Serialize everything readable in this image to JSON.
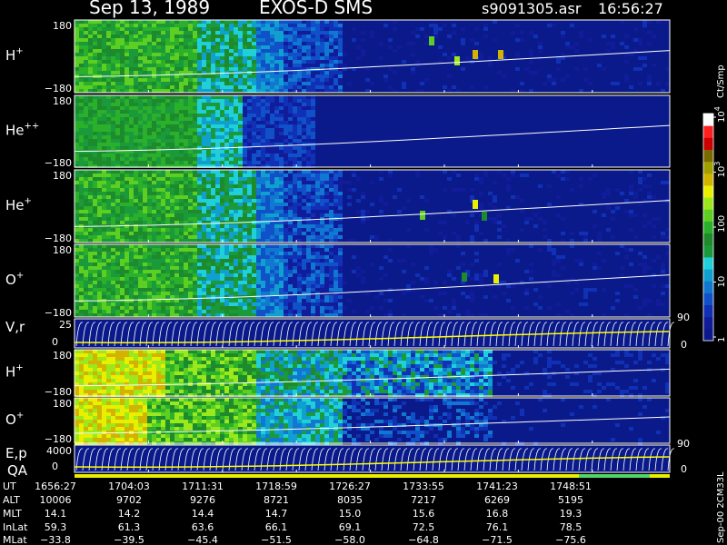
{
  "header": {
    "date": "Sep 13, 1989",
    "instrument": "EXOS-D SMS",
    "file": "s9091305.asr",
    "time": "16:56:27"
  },
  "colorbar": {
    "unit": "Ct/Smp",
    "ticks": [
      {
        "v": 1,
        "label": "1"
      },
      {
        "v": 10,
        "label": "10"
      },
      {
        "v": 100,
        "label": "100"
      },
      {
        "v": 1000,
        "label": "10",
        "sup": "3"
      },
      {
        "v": 10000,
        "label": "10",
        "sup": "4"
      }
    ],
    "colors": [
      "#0b1a8a",
      "#101c99",
      "#1030b5",
      "#1050c8",
      "#1078d0",
      "#10a0d0",
      "#20d0d8",
      "#1a9a3a",
      "#1d8a2c",
      "#2ab02a",
      "#5ccf22",
      "#9be81c",
      "#e8f000",
      "#d2b400",
      "#a0a000",
      "#7a6a00",
      "#cc0000",
      "#ff2020",
      "#ffffff"
    ]
  },
  "panels": [
    {
      "id": "h-plus",
      "label": "H",
      "sup": "+",
      "kind": "spec",
      "ymax": "180",
      "ymin": "−180",
      "pattern": "h"
    },
    {
      "id": "he-pp",
      "label": "He",
      "sup": "++",
      "kind": "spec",
      "ymax": "180",
      "ymin": "−180",
      "pattern": "hepp"
    },
    {
      "id": "he-plus",
      "label": "He",
      "sup": "+",
      "kind": "spec",
      "ymax": "180",
      "ymin": "−180",
      "pattern": "hep"
    },
    {
      "id": "o-plus",
      "label": "O",
      "sup": "+",
      "kind": "spec",
      "ymax": "180",
      "ymin": "−180",
      "pattern": "o"
    },
    {
      "id": "vr",
      "label": "V,r",
      "sup": "",
      "kind": "line",
      "ytop": "25",
      "ybot": "0",
      "rtop": "90",
      "rbot": "0"
    },
    {
      "id": "h-plus-2",
      "label": "H",
      "sup": "+",
      "kind": "spec",
      "ymax": "180",
      "ymin": "−180",
      "pattern": "h2"
    },
    {
      "id": "o-plus-2",
      "label": "O",
      "sup": "+",
      "kind": "spec",
      "ymax": "180",
      "ymin": "−180",
      "pattern": "o2"
    },
    {
      "id": "ep",
      "label": "E,p",
      "sup": "",
      "kind": "line",
      "ytop": "4000",
      "ybot": "0",
      "rtop": "90",
      "rbot": "0"
    }
  ],
  "qa": {
    "label": "QA"
  },
  "footer_note": "Sep-00 2CM33L",
  "table": {
    "labels": [
      "UT",
      "ALT",
      "MLT",
      "InLat",
      "MLat"
    ],
    "rows": [
      [
        "1656:27",
        "1704:03",
        "1711:31",
        "1718:59",
        "1726:27",
        "1733:55",
        "1741:23",
        "1748:51"
      ],
      [
        "10006",
        "9702",
        "9276",
        "8721",
        "8035",
        "7217",
        "6269",
        "5195"
      ],
      [
        "14.1",
        "14.2",
        "14.4",
        "14.7",
        "15.0",
        "15.6",
        "16.8",
        "19.3"
      ],
      [
        "59.3",
        "61.3",
        "63.6",
        "66.1",
        "69.1",
        "72.5",
        "76.1",
        "78.5"
      ],
      [
        "−33.8",
        "−39.5",
        "−45.4",
        "−51.5",
        "−58.0",
        "−64.8",
        "−71.5",
        "−75.6"
      ]
    ]
  }
}
